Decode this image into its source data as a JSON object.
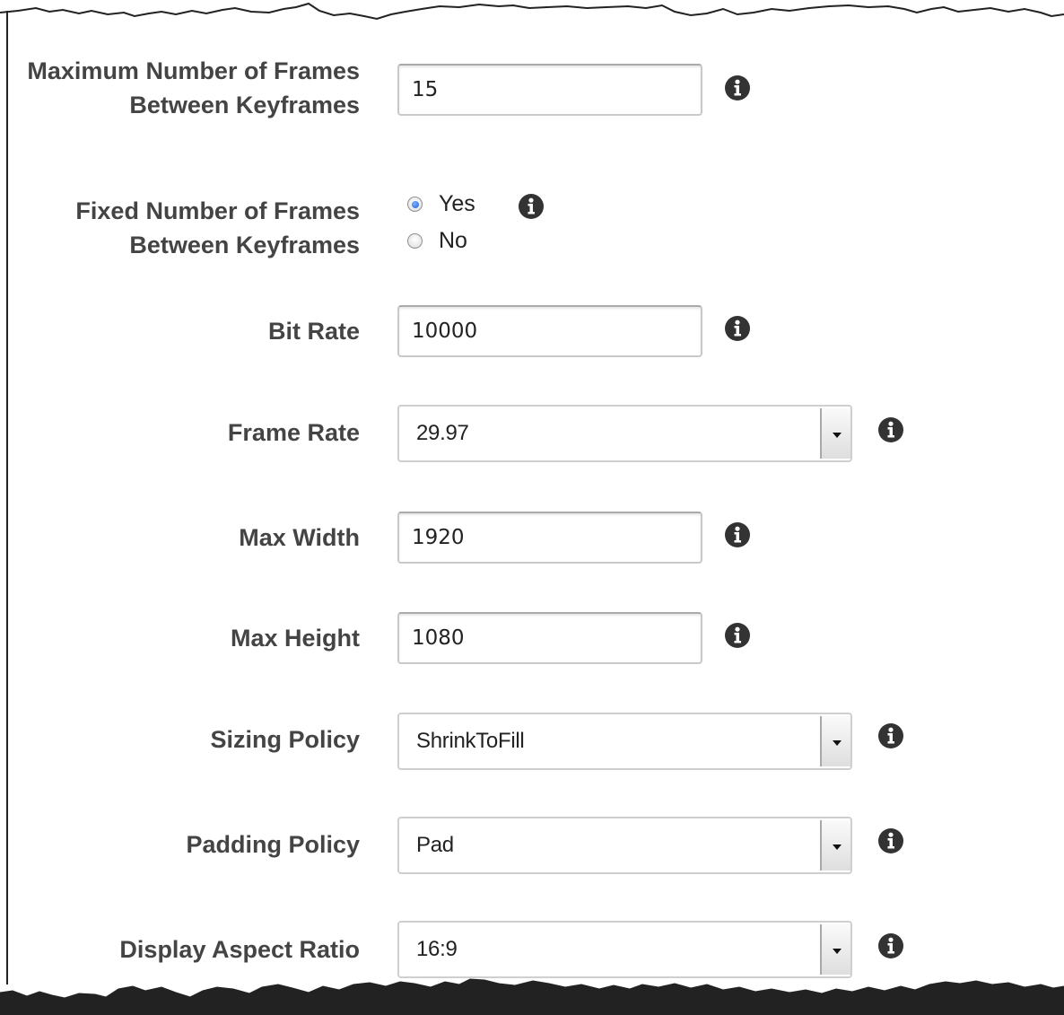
{
  "fields": {
    "max_frames": {
      "label": "Maximum Number of Frames Between Keyframes",
      "value": "15"
    },
    "fixed_frames": {
      "label": "Fixed Number of Frames Between Keyframes",
      "options": [
        "Yes",
        "No"
      ],
      "selected": "Yes"
    },
    "bit_rate": {
      "label": "Bit Rate",
      "value": "10000"
    },
    "frame_rate": {
      "label": "Frame Rate",
      "value": "29.97"
    },
    "max_width": {
      "label": "Max Width",
      "value": "1920"
    },
    "max_height": {
      "label": "Max Height",
      "value": "1080"
    },
    "sizing_policy": {
      "label": "Sizing Policy",
      "value": "ShrinkToFill"
    },
    "padding_policy": {
      "label": "Padding Policy",
      "value": "Pad"
    },
    "display_aspect_ratio": {
      "label": "Display Aspect Ratio",
      "value": "16:9"
    }
  },
  "icons": {
    "info": "info-icon",
    "dropdown": "chevron-down-icon"
  },
  "colors": {
    "label_text": "#444444",
    "info_icon": "#333333",
    "radio_selected": "#1f5fd0"
  }
}
